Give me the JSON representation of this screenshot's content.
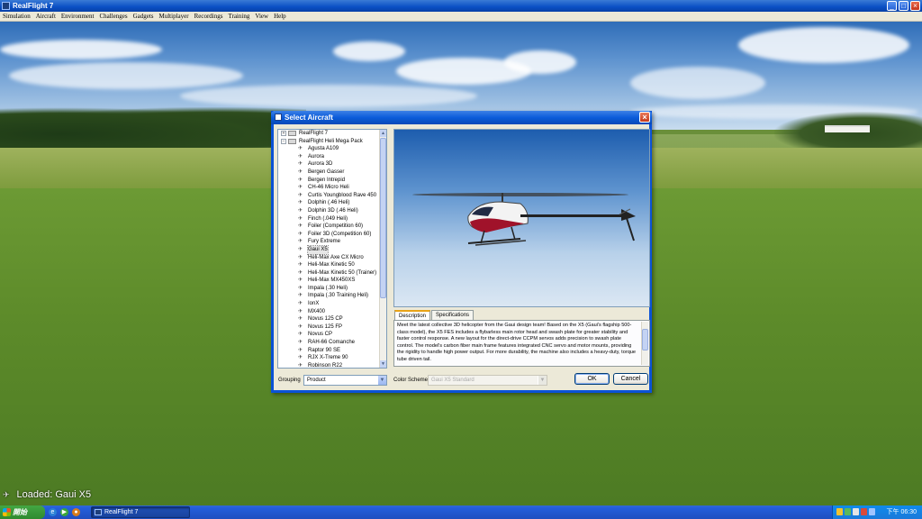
{
  "app": {
    "title": "RealFlight 7",
    "window_buttons": {
      "minimize": "_",
      "maximize": "□",
      "close": "×"
    }
  },
  "menu": [
    "Simulation",
    "Aircraft",
    "Environment",
    "Challenges",
    "Gadgets",
    "Multiplayer",
    "Recordings",
    "Training",
    "View",
    "Help"
  ],
  "status": {
    "text": "Loaded: Gaui X5",
    "icon": "airplane-icon"
  },
  "dialog": {
    "title": "Select Aircraft",
    "close_glyph": "×",
    "tree": {
      "roots": [
        {
          "label": "RealFlight 7",
          "expander": "+"
        },
        {
          "label": "RealFlight Heli Mega Pack",
          "expander": "−"
        }
      ],
      "children": [
        "Agusta A109",
        "Aurora",
        "Aurora 3D",
        "Bergen Gasser",
        "Bergen Intrepid",
        "CH-46 Micro Heli",
        "Curtis Youngblood Rave 450",
        "Dolphin (.46 Heli)",
        "Dolphin 3D (.46 Heli)",
        "Finch (.049 Heli)",
        "Foiler (Competition 60)",
        "Foiler 3D (Competition 60)",
        "Fury Extreme",
        "Gaui X5",
        "Heli-Max Axe CX Micro",
        "Heli-Max Kinetic 50",
        "Heli-Max Kinetic 50 (Trainer)",
        "Heli-Max MX450XS",
        "Impala (.30 Heli)",
        "Impala (.30 Training Heli)",
        "IonX",
        "MX400",
        "Novus 125 CP",
        "Novus 125 FP",
        "Novus CP",
        "RAH-66 Comanche",
        "Raptor 90 SE",
        "RJX X-Treme 90",
        "Robinson R22"
      ],
      "selected": "Gaui X5"
    },
    "grouping": {
      "label": "Grouping",
      "value": "Product"
    },
    "tabs": [
      "Description",
      "Specifications"
    ],
    "active_tab": "Description",
    "description": "Meet the latest collective 3D helicopter from the Gaui design team! Based on the X5 (Gaui's flagship 500-class model), the X5 FES includes a flybarless main rotor head and swash plate for greater stability and faster control response. A new layout for the direct-drive CCPM servos adds precision to swash plate control. The model's carbon fiber main frame features integrated CNC servo and motor mounts, providing the rigidity to handle high power output. For more durability, the machine also includes a heavy-duty, torque tube driven tail.",
    "color_scheme": {
      "label": "Color Scheme",
      "value": "Gaui X5 Standard"
    },
    "ok_label": "OK",
    "cancel_label": "Cancel",
    "dropdown_glyph": "▼"
  },
  "taskbar": {
    "start_label": "開始",
    "task_label": "RealFlight 7",
    "clock": "下午 06:30"
  },
  "colors": {
    "xp_blue": "#0a52d6",
    "dialog_bg": "#ece9d8",
    "grass": "#5d8b2a",
    "sky": "#5e93cf"
  }
}
